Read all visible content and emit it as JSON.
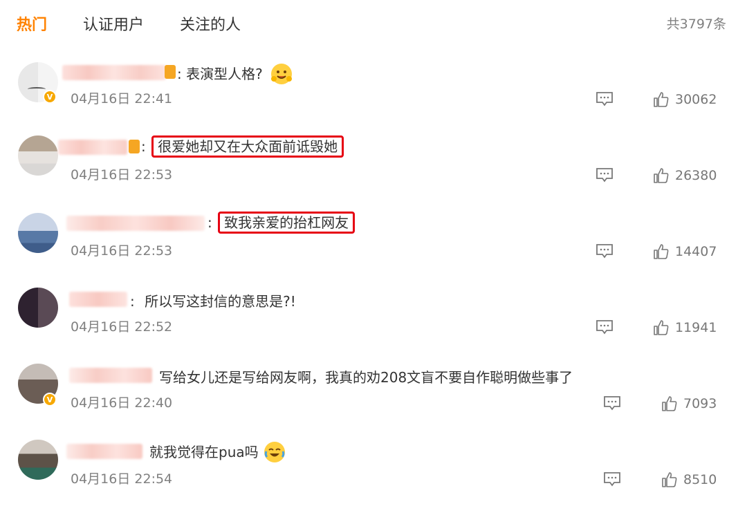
{
  "tabs": [
    {
      "label": "热门",
      "active": true
    },
    {
      "label": "认证用户",
      "active": false
    },
    {
      "label": "关注的人",
      "active": false
    }
  ],
  "total_label": "共3797条",
  "accent_color": "#ff8200",
  "highlight_color": "#e60012",
  "comments": [
    {
      "separator": ":",
      "text": "表演型人格?",
      "emoji": "smiling-face-with-hands-emoji",
      "time": "04月16日 22:41",
      "likes": "30062",
      "verified": true,
      "highlighted": false
    },
    {
      "separator": ":",
      "text": "很爱她却又在大众面前诋毁她",
      "time": "04月16日 22:53",
      "likes": "26380",
      "verified": false,
      "highlighted": true
    },
    {
      "separator": ":",
      "text": "致我亲爱的抬杠网友",
      "time": "04月16日 22:53",
      "likes": "14407",
      "verified": false,
      "highlighted": true
    },
    {
      "separator": ":",
      "text": "所以写这封信的意思是?!",
      "time": "04月16日 22:52",
      "likes": "11941",
      "verified": false,
      "highlighted": false
    },
    {
      "separator": "",
      "text": "写给女儿还是写给网友啊，我真的劝208文盲不要自作聪明做些事了",
      "time": "04月16日 22:40",
      "likes": "7093",
      "verified": true,
      "highlighted": false
    },
    {
      "separator": "",
      "text": "就我觉得在pua吗",
      "emoji": "crying-laughing-emoji",
      "time": "04月16日 22:54",
      "likes": "8510",
      "verified": false,
      "highlighted": false
    }
  ]
}
